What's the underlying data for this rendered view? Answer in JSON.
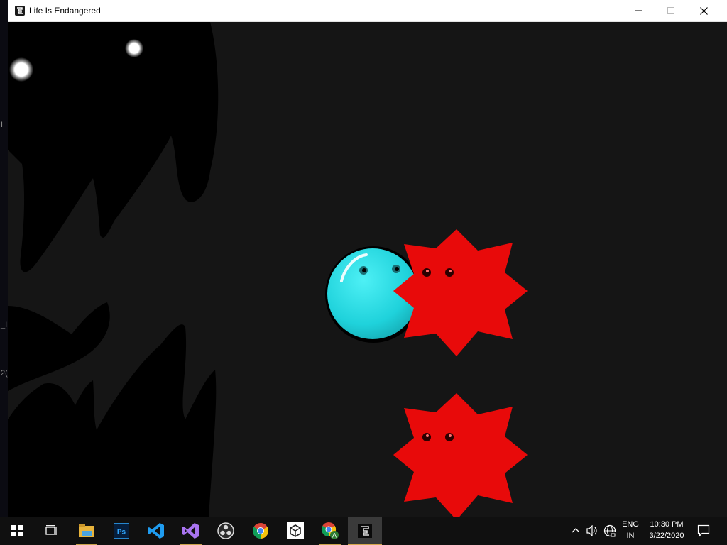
{
  "window": {
    "title": "Life Is Endangered"
  },
  "desktop_fragments": [
    "I",
    "_I",
    "2("
  ],
  "game": {
    "player": {
      "type": "cyan-bubble"
    },
    "enemies": [
      {
        "type": "red-spiky-star"
      },
      {
        "type": "red-spiky-star"
      }
    ],
    "shadow_monster": {
      "eyes": 2
    }
  },
  "taskbar": {
    "apps": [
      {
        "name": "start-icon"
      },
      {
        "name": "task-view-icon"
      },
      {
        "name": "file-explorer-icon"
      },
      {
        "name": "photoshop-icon",
        "label": "Ps"
      },
      {
        "name": "vscode-icon"
      },
      {
        "name": "visual-studio-icon"
      },
      {
        "name": "obs-icon"
      },
      {
        "name": "chrome-icon"
      },
      {
        "name": "unity-icon"
      },
      {
        "name": "chrome-profile-icon",
        "badge": "A"
      },
      {
        "name": "life-is-endangered-icon"
      }
    ],
    "tray": {
      "language_line1": "ENG",
      "language_line2": "IN",
      "time": "10:30 PM",
      "date": "3/22/2020"
    }
  },
  "colors": {
    "background": "#151515",
    "player": "#21d3dc",
    "enemy": "#e80a0a",
    "taskbar": "#101010",
    "accent_underline": "#c8a24a"
  }
}
